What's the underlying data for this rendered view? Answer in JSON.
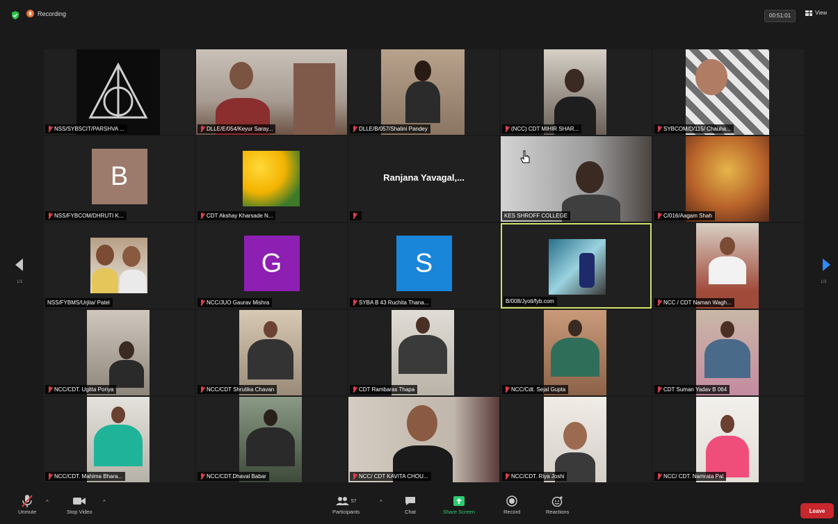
{
  "top": {
    "recording_label": "Recording",
    "timer": "00:51:01",
    "view_label": "View"
  },
  "pagination": {
    "left": "1/3",
    "right": "1/3"
  },
  "tiles": [
    {
      "label": "NSS/SYBSCIT/PARSHVA ..."
    },
    {
      "label": "DLLE/E/054/Keyur Saray..."
    },
    {
      "label": "DLLE/B/057/Shalini Pandey"
    },
    {
      "label": "(NCC) CDT MIHIR SHAR..."
    },
    {
      "label": "SYBCOM/D/115/ Chauha..."
    },
    {
      "label": "NSS/FYBCOM/DHRUTI K...",
      "initial": "B"
    },
    {
      "label": "CDT Akshay Kharsade N..."
    },
    {
      "label": "",
      "display_name": "Ranjana  Yavagal,..."
    },
    {
      "label": "KES SHROFF COLLEGE"
    },
    {
      "label": "C/016/Aagam Shah"
    },
    {
      "label": "NSS/FYBMS/Urjita/ Patel"
    },
    {
      "label": "NCC/JUO Gaurav Mishra",
      "initial": "G"
    },
    {
      "label": "SYBA B 43 Ruchita Thana...",
      "initial": "S"
    },
    {
      "label": "B/008/Jyoti/fyb.com"
    },
    {
      "label": "NCC / CDT Naman Wagh..."
    },
    {
      "label": "NCC/CDT. Ugitta Poriya"
    },
    {
      "label": "NCC/CDT Shrutika Chavan"
    },
    {
      "label": "CDT Rambaras Thapa"
    },
    {
      "label": "NCC/Cdt. Sejal Gupta"
    },
    {
      "label": "CDT Suman Yadav B 064"
    },
    {
      "label": "NCC/CDT. Mahima Bhara..."
    },
    {
      "label": "NCC/CDT.Dhaval Babar"
    },
    {
      "label": "NCC/ CDT KAVITA CHOU..."
    },
    {
      "label": "NCC/CDT. Riya Joshi"
    },
    {
      "label": "NCC/ CDT. Namrata Pal"
    }
  ],
  "toolbar": {
    "unmute": "Unmute",
    "stop_video": "Stop Video",
    "participants": "Participants",
    "participants_count": "57",
    "chat": "Chat",
    "share_screen": "Share Screen",
    "record": "Record",
    "reactions": "Reactions",
    "leave": "Leave"
  },
  "colors": {
    "avatar_b": "#9c7b6c",
    "avatar_g": "#8e1fb3",
    "avatar_s": "#1a86d9",
    "active_border": "#d3e26b",
    "leave": "#c8272d",
    "share": "#2ecc71"
  }
}
